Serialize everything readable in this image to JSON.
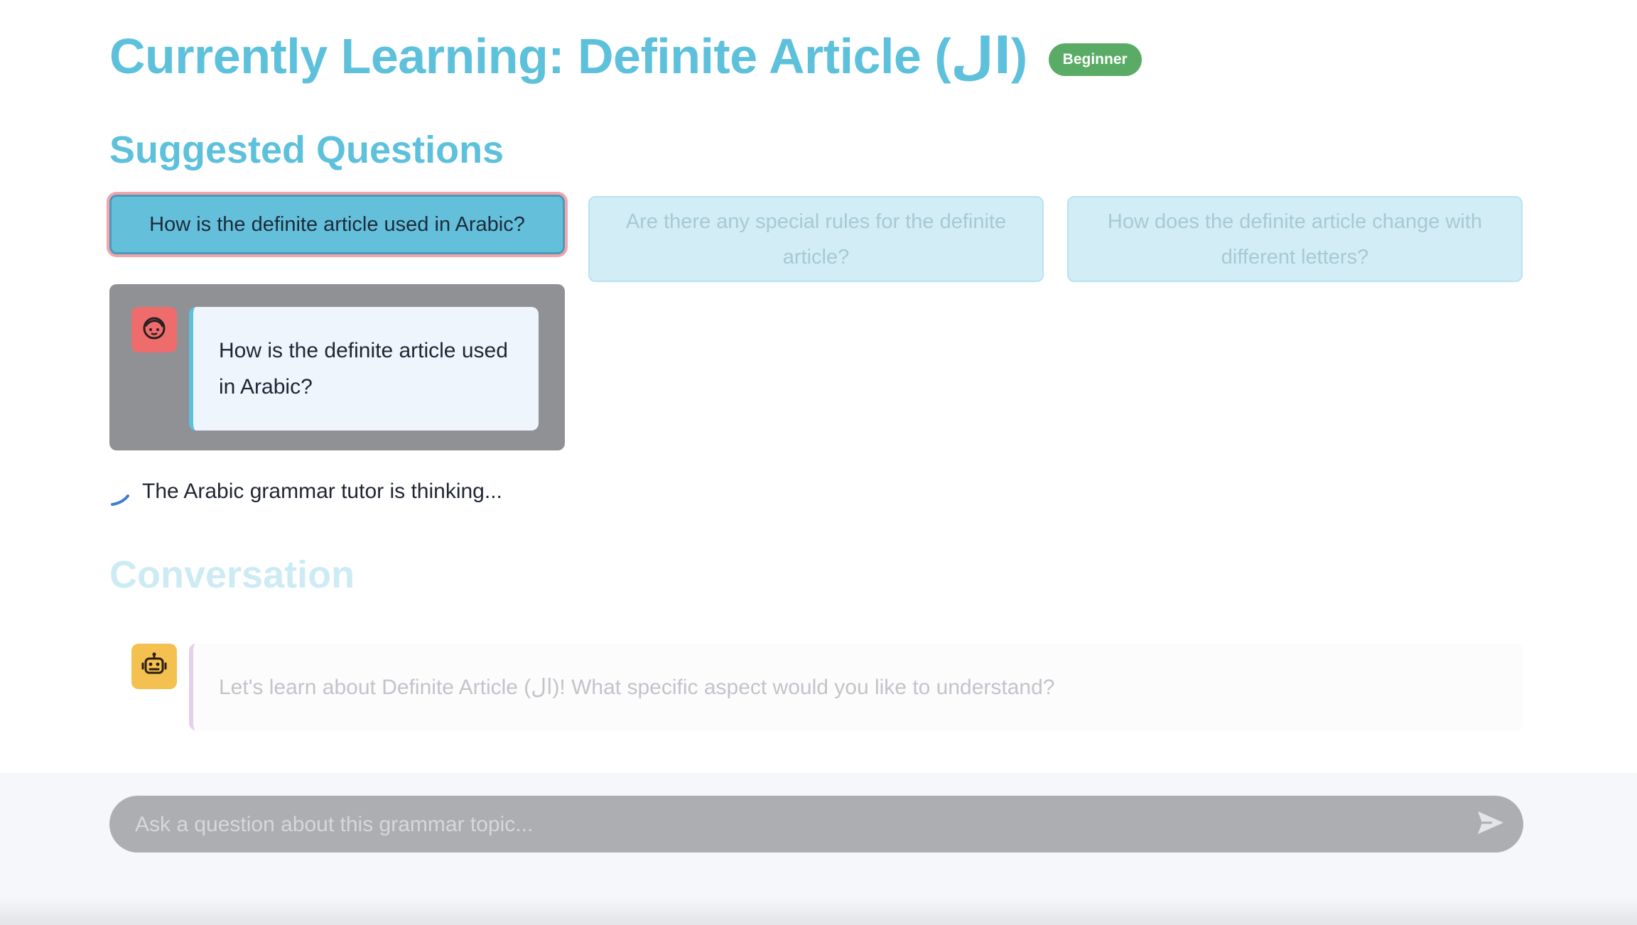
{
  "header": {
    "title": "Currently Learning: Definite Article (ال)",
    "level_badge": "Beginner"
  },
  "suggested": {
    "heading": "Suggested Questions",
    "questions": [
      "How is the definite article used in Arabic?",
      "Are there any special rules for the definite article?",
      "How does the definite article change with different letters?"
    ]
  },
  "user_message": {
    "avatar_icon": "face-icon",
    "text": "How is the definite article used in Arabic?"
  },
  "status": {
    "thinking_text": "The Arabic grammar tutor is thinking..."
  },
  "conversation": {
    "heading": "Conversation",
    "messages": [
      {
        "role": "assistant",
        "avatar_icon": "robot-icon",
        "text": "Let's learn about Definite Article (ال)! What specific aspect would you like to understand?"
      }
    ]
  },
  "chat_input": {
    "placeholder": "Ask a question about this grammar topic...",
    "send_icon": "send-icon"
  },
  "colors": {
    "accent": "#5ec1dc",
    "badge": "#5aab66",
    "user_avatar": "#ee6d6c",
    "bot_avatar": "#f4c04f"
  }
}
